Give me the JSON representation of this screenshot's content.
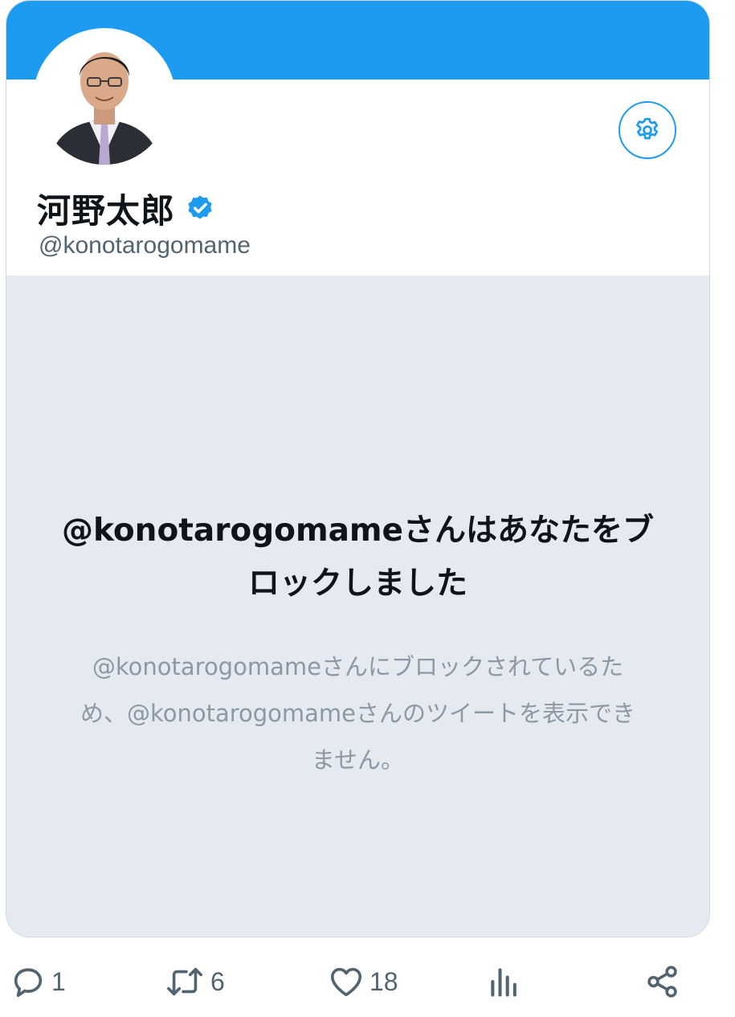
{
  "profile": {
    "display_name": "河野太郎",
    "handle": "@konotarogomame",
    "verified": true
  },
  "blocked": {
    "title": "@konotarogomameさんはあなたをブロックしました",
    "message": "@konotarogomameさんにブロックされているため、@konotarogomameさんのツイートを表示できません。"
  },
  "actions": {
    "reply_count": "1",
    "retweet_count": "6",
    "like_count": "18"
  },
  "colors": {
    "accent": "#1d9bf0",
    "blocked_bg": "#e5eaf0",
    "icon_gray": "#536471"
  }
}
